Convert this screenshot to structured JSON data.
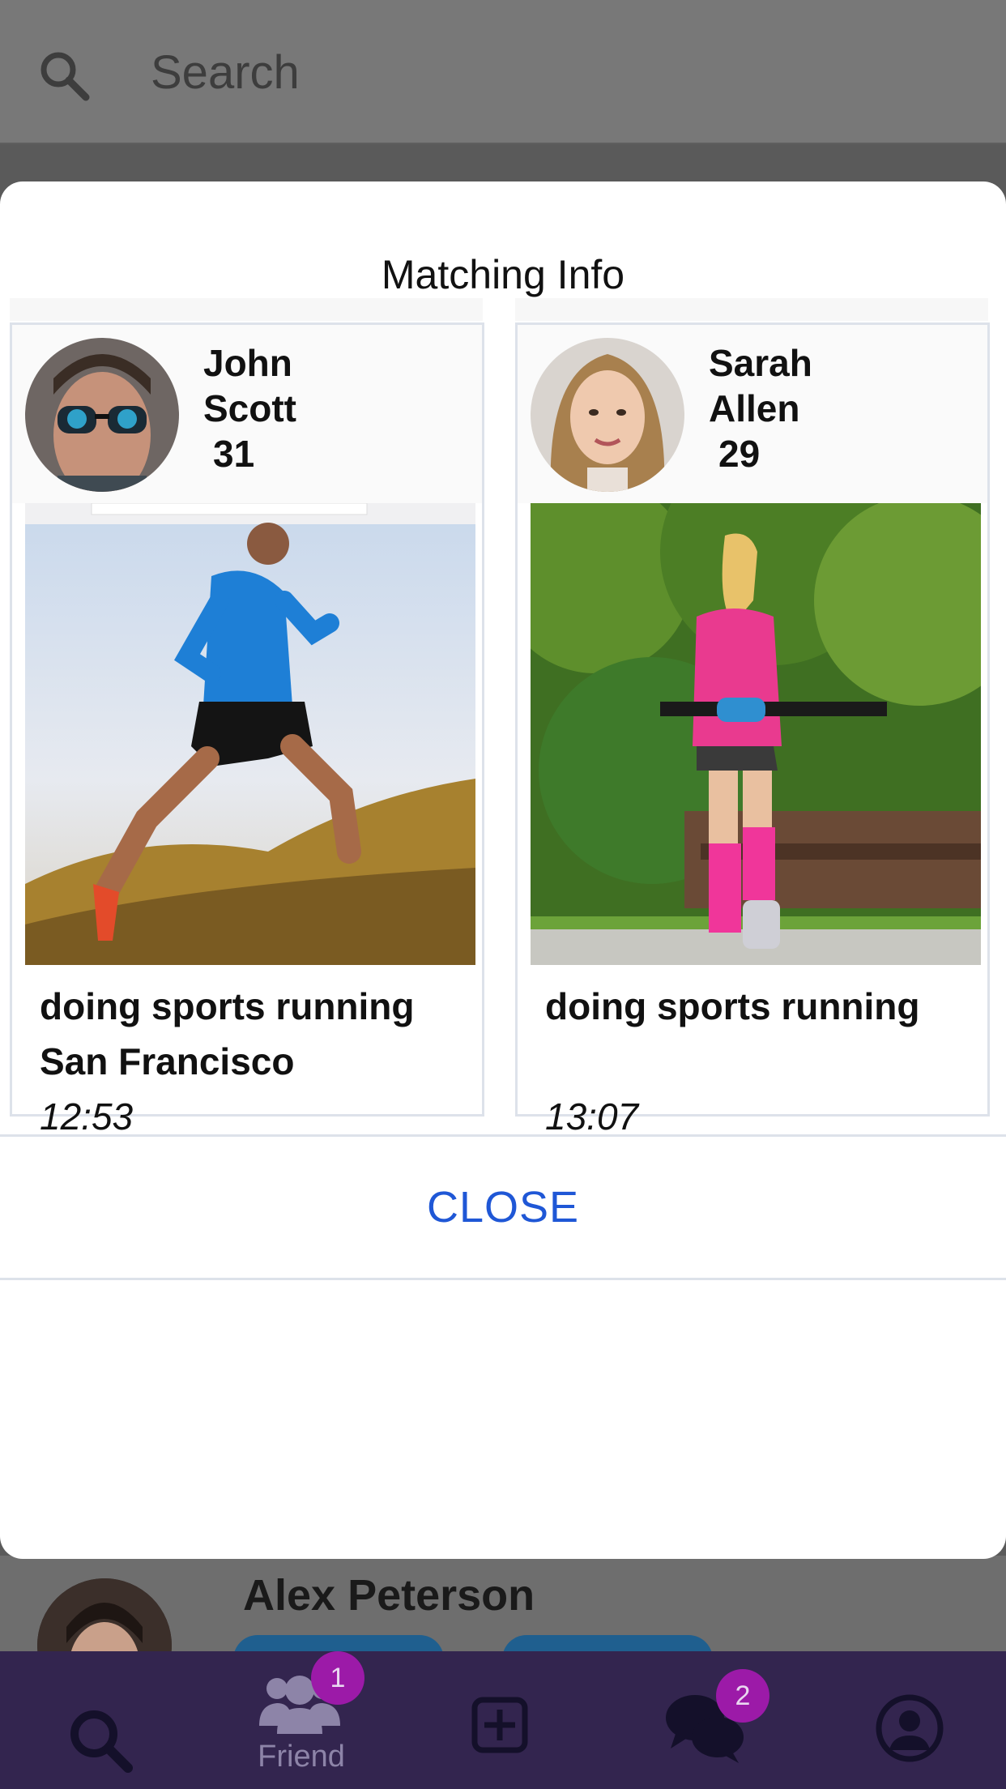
{
  "search": {
    "placeholder": "Search",
    "icon": "search-icon"
  },
  "modal": {
    "title": "Matching Info",
    "close_label": "CLOSE",
    "cards": [
      {
        "first_name": "John",
        "last_name": "Scott",
        "age": "31",
        "activity": "doing sports running",
        "location": "San Francisco",
        "time": "12:53"
      },
      {
        "first_name": "Sarah",
        "last_name": "Allen",
        "age": "29",
        "activity": "doing sports running",
        "location": "",
        "time": "13:07"
      }
    ]
  },
  "background_list": {
    "name": "Alex Peterson"
  },
  "tabbar": {
    "items": [
      {
        "icon": "search-icon",
        "label": ""
      },
      {
        "icon": "friends-icon",
        "label": "Friend",
        "badge": "1"
      },
      {
        "icon": "add-square-icon",
        "label": ""
      },
      {
        "icon": "chat-icon",
        "label": "",
        "badge": "2"
      },
      {
        "icon": "profile-icon",
        "label": ""
      }
    ]
  },
  "colors": {
    "accent_link": "#1f57d6",
    "tabbar_bg": "#33254f",
    "badge_bg": "#9c1aa8"
  }
}
